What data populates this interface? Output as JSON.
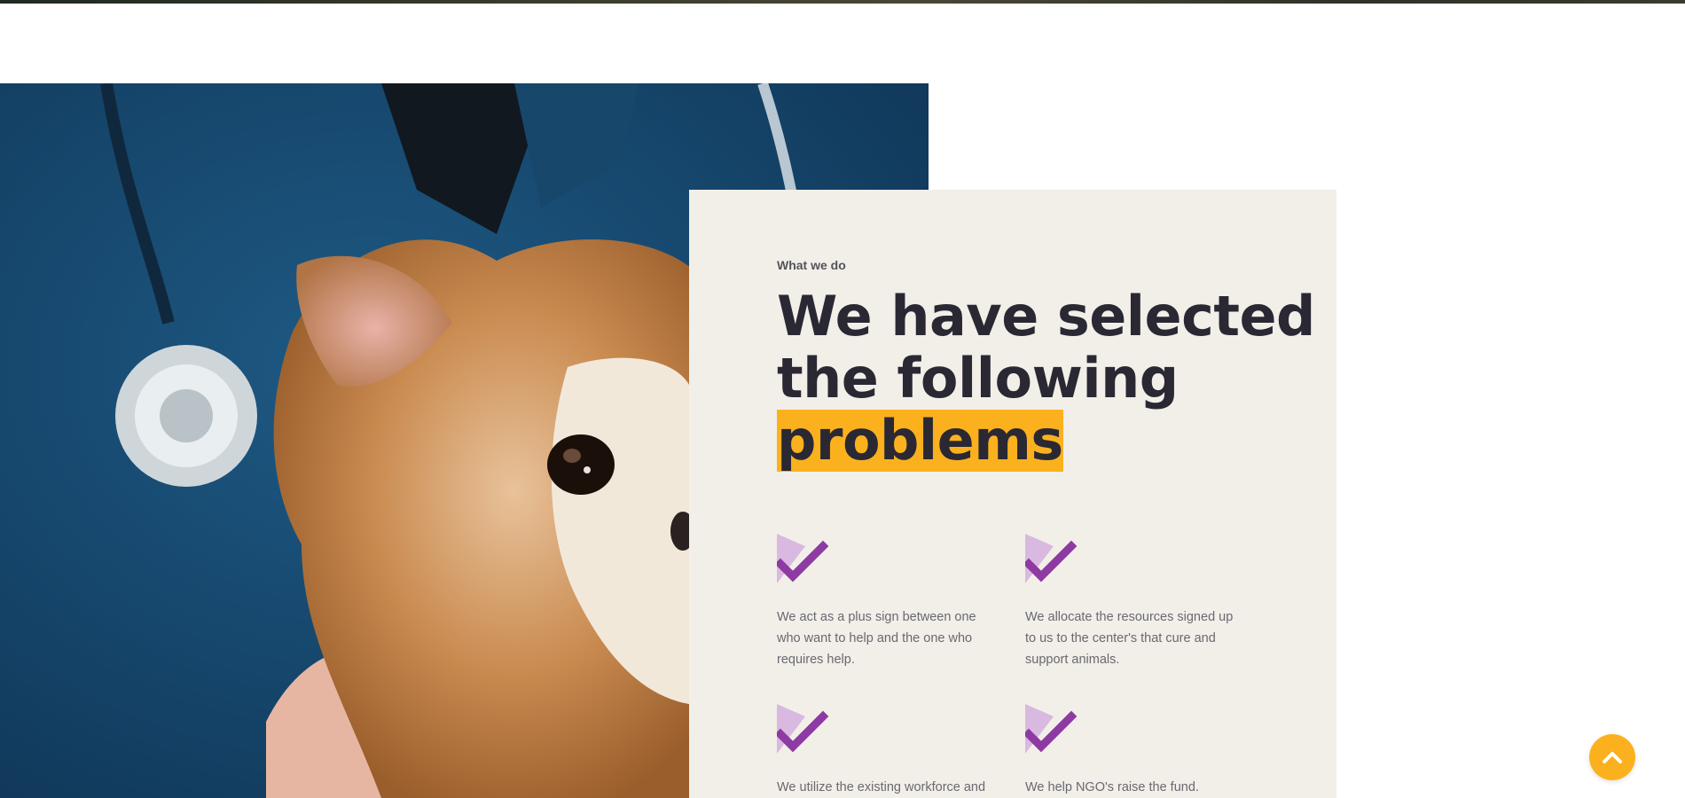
{
  "section": {
    "eyebrow": "What we do",
    "heading_line1": "We have selected",
    "heading_line2": "the following",
    "heading_highlight": "problems"
  },
  "features": [
    {
      "icon": "check-icon",
      "text": "We act as a plus sign between one who want to help and the one who requires help."
    },
    {
      "icon": "check-icon",
      "text": "We allocate the resources signed up to us to the center's that cure and support animals."
    },
    {
      "icon": "check-icon",
      "text": "We utilize the existing workforce and"
    },
    {
      "icon": "check-icon",
      "text": "We help NGO's raise the fund."
    }
  ],
  "scroll_top": {
    "icon": "chevron-up-icon"
  },
  "colors": {
    "accent": "#fbb11e",
    "check_purple": "#8e3aa3",
    "check_light": "#d9b9df",
    "card_bg": "#f2efe9",
    "heading": "#2a2833"
  }
}
